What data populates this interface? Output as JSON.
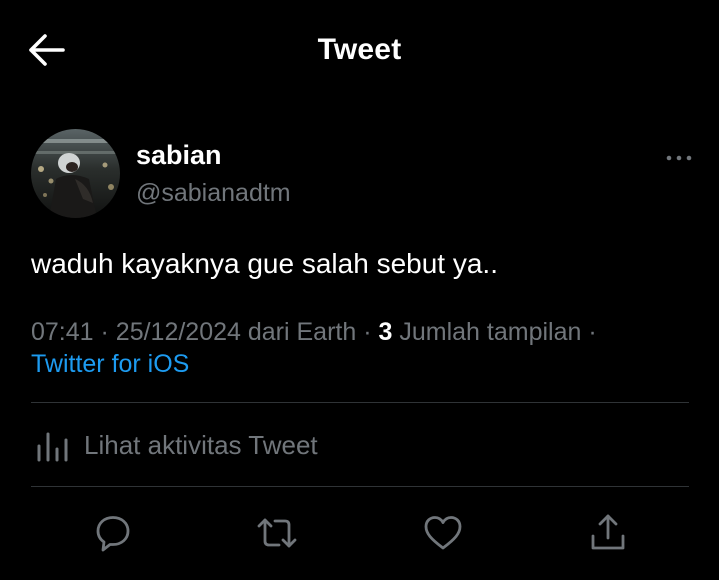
{
  "header": {
    "title": "Tweet",
    "back_icon": "arrow-left-icon"
  },
  "author": {
    "display_name": "sabian",
    "handle": "@sabianadtm",
    "more_icon": "more-horizontal-icon"
  },
  "tweet": {
    "text": "waduh kayaknya gue salah sebut ya.."
  },
  "meta": {
    "time": "07:41",
    "separator": "·",
    "date": "25/12/2024",
    "location": "dari Earth",
    "views_count": "3",
    "views_label": "Jumlah tampilan",
    "source": "Twitter for iOS"
  },
  "activity": {
    "label": "Lihat aktivitas Tweet",
    "icon": "bar-chart-icon"
  },
  "actions": {
    "reply_icon": "reply-icon",
    "retweet_icon": "retweet-icon",
    "like_icon": "heart-icon",
    "share_icon": "share-icon"
  },
  "colors": {
    "background": "#000000",
    "primary_text": "#ffffff",
    "secondary_text": "#71767b",
    "link": "#1d9bf0",
    "divider": "#2f3336"
  }
}
